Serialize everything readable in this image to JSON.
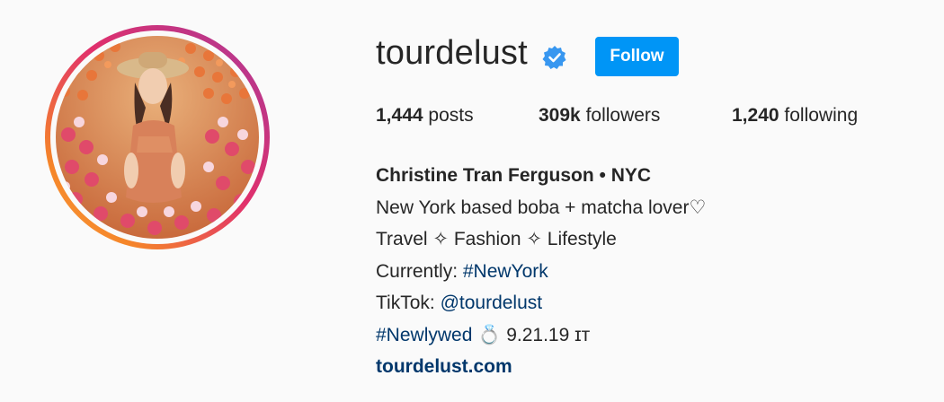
{
  "profile": {
    "username": "tourdelust",
    "follow_label": "Follow",
    "stats": {
      "posts_count": "1,444",
      "posts_label": "posts",
      "followers_count": "309k",
      "followers_label": "followers",
      "following_count": "1,240",
      "following_label": "following"
    },
    "bio": {
      "full_name": "Christine Tran Ferguson • NYC",
      "line1": "New York based boba + matcha lover♡",
      "line2": "Travel ✧ Fashion ✧ Lifestyle",
      "line3_prefix": "Currently: ",
      "line3_hashtag": "#NewYork",
      "line4_prefix": "TikTok: ",
      "line4_mention": "@tourdelust",
      "line5_hashtag": "#Newlywed",
      "line5_rest": " 💍 9.21.19 ɪᴛ",
      "website": "tourdelust.com"
    }
  },
  "icons": {
    "verified": "verified-badge-icon"
  },
  "colors": {
    "follow_button": "#0095f6",
    "link": "#00376b",
    "verified": "#3897f0",
    "background": "#fafafa"
  }
}
